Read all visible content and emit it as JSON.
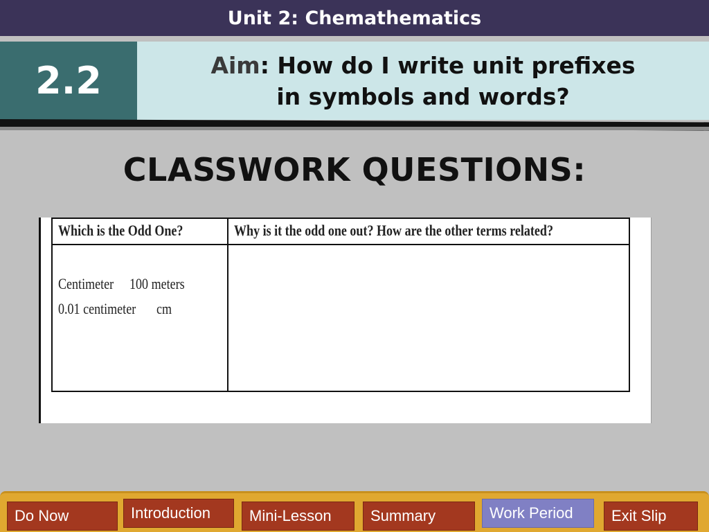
{
  "header": {
    "unit_title": "Unit 2: Chemathematics",
    "lesson_number": "2.2",
    "aim_label": "Aim",
    "aim_line1_rest": ": How do I write unit prefixes",
    "aim_line2": "in symbols and words?"
  },
  "main": {
    "heading": "CLASSWORK QUESTIONS:",
    "table": {
      "headers": [
        "Which is the Odd One?",
        "Why is it the odd one out? How are the other terms related?"
      ],
      "terms": [
        "Centimeter",
        "100 meters",
        "0.01 centimeter",
        "cm"
      ],
      "answer": ""
    }
  },
  "nav": {
    "items": [
      {
        "label": "Do Now"
      },
      {
        "label": "Introduction"
      },
      {
        "label": "Mini-Lesson"
      },
      {
        "label": "Summary"
      },
      {
        "label": "Work Period"
      },
      {
        "label": "Exit Slip"
      }
    ],
    "active": "Work Period"
  },
  "colors": {
    "unit_bar": "#3b3358",
    "lesson_block": "#3a6d6f",
    "aim_band": "#cce6e8",
    "nav_bar": "#e0a830",
    "nav_button": "#a3381f",
    "nav_button_active": "#8080c4"
  }
}
